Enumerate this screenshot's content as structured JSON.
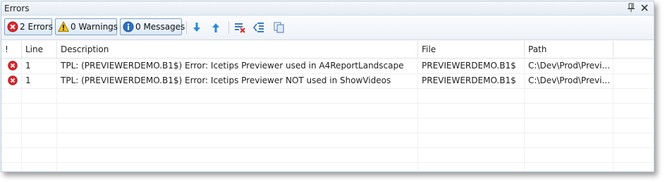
{
  "panel": {
    "title": "Errors"
  },
  "toolbar": {
    "errors_label": "2 Errors",
    "warnings_label": "0 Warnings",
    "messages_label": "0 Messages"
  },
  "columns": [
    "!",
    "Line",
    "Description",
    "File",
    "Path"
  ],
  "rows": [
    {
      "line": "1",
      "description": "TPL: (PREVIEWERDEMO.B1$) Error: Icetips Previewer used in A4ReportLandscape",
      "file": "PREVIEWERDEMO.B1$",
      "path": "C:\\Dev\\Prod\\Previ..."
    },
    {
      "line": "1",
      "description": "TPL: (PREVIEWERDEMO.B1$) Error: Icetips Previewer NOT used in ShowVideos",
      "file": "PREVIEWERDEMO.B1$",
      "path": "C:\\Dev\\Prod\\Previ..."
    }
  ],
  "icons": {
    "error": "error-circle-x-icon",
    "warning": "warning-triangle-icon",
    "info": "info-icon",
    "next": "arrow-down-icon",
    "prev": "arrow-up-icon",
    "clear": "clear-list-icon",
    "outdent": "indent-list-icon",
    "copy": "copy-icon"
  },
  "colors": {
    "error": "#d9282f",
    "warning": "#f4c320",
    "info": "#2f72c4",
    "accent": "#2a8ad6"
  }
}
